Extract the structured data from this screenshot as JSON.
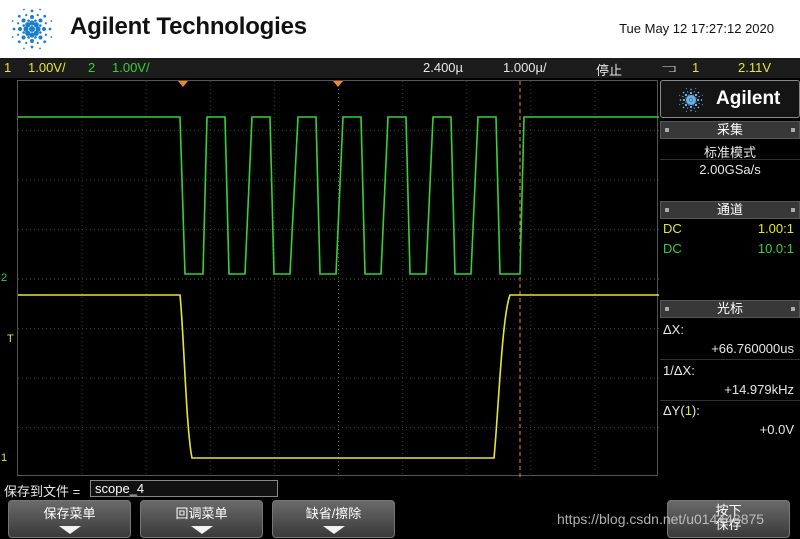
{
  "header": {
    "brand": "Agilent Technologies",
    "datetime": "Tue May 12 17:27:12 2020",
    "logo_icon": "agilent-spark-icon",
    "logo_color": "#1a7fc8"
  },
  "status": {
    "ch1_num": "1",
    "ch1_scale": "1.00V/",
    "ch2_num": "2",
    "ch2_scale": "1.00V/",
    "time_delay": "2.400µ",
    "time_scale": "1.000µ/",
    "run_state": "停止",
    "trigger_slope_icon": "⫎",
    "trigger_source": "1",
    "trigger_level": "2.11V"
  },
  "screen": {
    "ch1_color": "#e6e633",
    "ch2_color": "#37d137",
    "ch2_marker": "2",
    "ch1_marker": "1",
    "trigger_level_marker": "T"
  },
  "panel": {
    "brand": "Agilent",
    "acquire": {
      "title": "采集",
      "mode": "标准模式",
      "rate": "2.00GSa/s"
    },
    "channels": {
      "title": "通道",
      "rows": [
        {
          "coupling": "DC",
          "probe": "1.00:1",
          "color": "#e6e633"
        },
        {
          "coupling": "DC",
          "probe": "10.0:1",
          "color": "#37d137"
        }
      ]
    },
    "cursors": {
      "title": "光标",
      "dx_label": "ΔX:",
      "dx_value": "+66.760000us",
      "inv_dx_label": "1/ΔX:",
      "inv_dx_value": "+14.979kHz",
      "dy_label_pre": "ΔY(",
      "dy_label_ch": "1",
      "dy_label_post": "):",
      "dy_value": "+0.0V"
    }
  },
  "save": {
    "label": "保存到文件 =",
    "filename": "scope_4"
  },
  "softkeys": [
    {
      "label": "保存菜单"
    },
    {
      "label": "回调菜单"
    },
    {
      "label": "缺省/擦除"
    },
    {
      "label": "按下\n保存"
    }
  ],
  "watermark": "https://blog.csdn.net/u014448875"
}
